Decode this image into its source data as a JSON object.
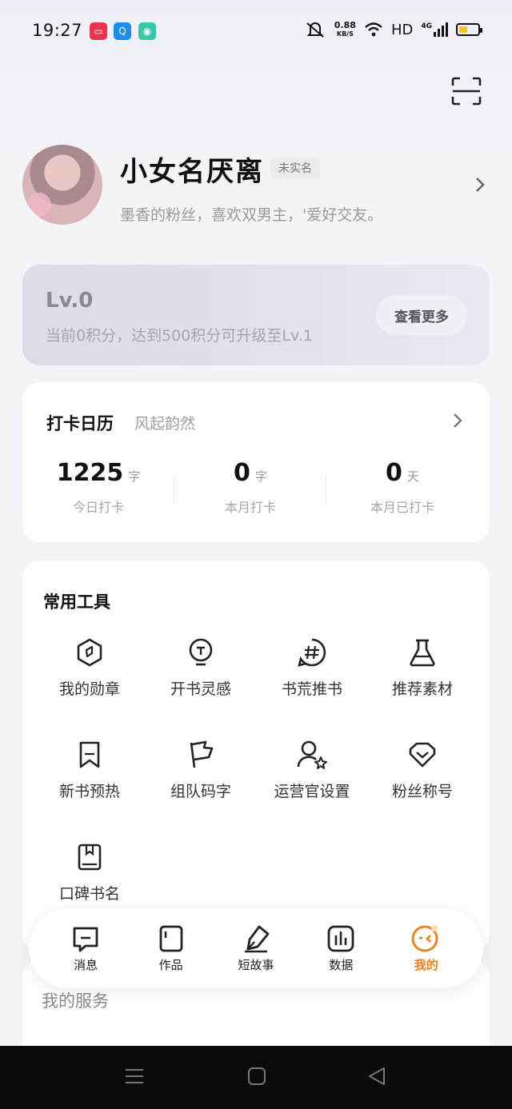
{
  "status": {
    "time": "19:27",
    "speed_value": "0.88",
    "speed_unit": "KB/S",
    "network": "HD",
    "cell": "4G"
  },
  "profile": {
    "name": "小女名厌离",
    "badge": "未实名",
    "bio": "墨香的粉丝，喜欢双男主，'爱好交友。"
  },
  "level": {
    "title": "Lv.0",
    "desc": "当前0积分，达到500积分可升级至Lv.1",
    "more_label": "查看更多"
  },
  "checkin": {
    "title": "打卡日历",
    "subtitle": "风起韵然",
    "stats": [
      {
        "num": "1225",
        "unit": "字",
        "label": "今日打卡"
      },
      {
        "num": "0",
        "unit": "字",
        "label": "本月打卡"
      },
      {
        "num": "0",
        "unit": "天",
        "label": "本月已打卡"
      }
    ]
  },
  "tools": {
    "title": "常用工具",
    "items": [
      {
        "label": "我的勋章",
        "icon": "medal-icon"
      },
      {
        "label": "开书灵感",
        "icon": "lightbulb-icon"
      },
      {
        "label": "书荒推书",
        "icon": "hashtag-icon"
      },
      {
        "label": "推荐素材",
        "icon": "flask-icon"
      },
      {
        "label": "新书预热",
        "icon": "bookmark-icon"
      },
      {
        "label": "组队码字",
        "icon": "flag-icon"
      },
      {
        "label": "运营官设置",
        "icon": "user-star-icon"
      },
      {
        "label": "粉丝称号",
        "icon": "heart-shield-icon"
      },
      {
        "label": "口碑书名",
        "icon": "book-icon"
      }
    ]
  },
  "services": {
    "title": "我的服务"
  },
  "tabbar": {
    "items": [
      {
        "label": "消息",
        "icon": "message-icon",
        "active": false
      },
      {
        "label": "作品",
        "icon": "document-icon",
        "active": false
      },
      {
        "label": "短故事",
        "icon": "pen-icon",
        "active": false
      },
      {
        "label": "数据",
        "icon": "chart-icon",
        "active": false
      },
      {
        "label": "我的",
        "icon": "face-icon",
        "active": true
      }
    ],
    "active_color": "#f07c1a"
  }
}
